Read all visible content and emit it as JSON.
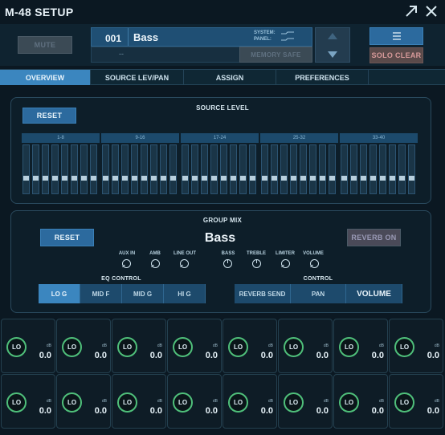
{
  "window": {
    "title": "M-48 SETUP"
  },
  "top": {
    "mute_label": "MUTE",
    "patch_number": "001",
    "patch_name": "Bass",
    "system_label": "SYSTEM:",
    "panel_label": "PANEL:",
    "second_row_value": "--",
    "memory_safe_label": "MEMORY SAFE",
    "menu_icon": "menu-icon",
    "solo_clear_label": "SOLO CLEAR"
  },
  "tabs": [
    {
      "label": "OVERVIEW",
      "active": true
    },
    {
      "label": "SOURCE LEV/PAN",
      "active": false
    },
    {
      "label": "ASSIGN",
      "active": false
    },
    {
      "label": "PREFERENCES",
      "active": false
    }
  ],
  "source_level": {
    "title": "SOURCE LEVEL",
    "reset_label": "RESET",
    "groups": [
      "1-8",
      "9-16",
      "17-24",
      "25-32",
      "33-40"
    ]
  },
  "group_mix": {
    "title": "GROUP MIX",
    "reset_label": "RESET",
    "name": "Bass",
    "reverb_label": "REVERB ON",
    "knobs": [
      "AUX IN",
      "AMB",
      "LINE OUT",
      "BASS",
      "TREBLE",
      "LIMITER",
      "VOLUME"
    ],
    "eq_control_label": "EQ CONTROL",
    "eq_buttons": [
      "LO G",
      "MID F",
      "MID G",
      "HI G"
    ],
    "control_label": "CONTROL",
    "control_buttons": [
      "REVERB SEND",
      "PAN",
      "VOLUME"
    ]
  },
  "channels": {
    "knob_label": "LO",
    "unit": "dB",
    "values": [
      "0.0",
      "0.0",
      "0.0",
      "0.0",
      "0.0",
      "0.0",
      "0.0",
      "0.0",
      "0.0",
      "0.0",
      "0.0",
      "0.0",
      "0.0",
      "0.0",
      "0.0",
      "0.0"
    ]
  },
  "colors": {
    "accent": "#3b86bf",
    "knob_ring": "#4fbf7a",
    "bg": "#0b1822"
  }
}
